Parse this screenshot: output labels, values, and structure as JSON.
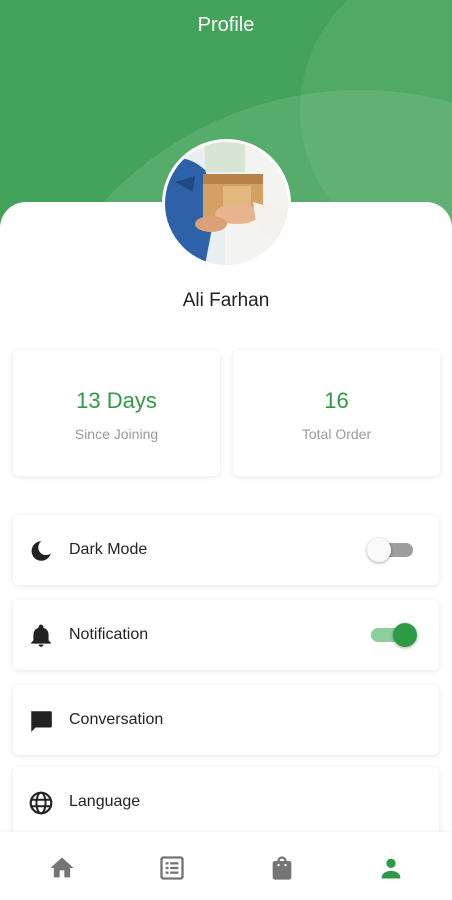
{
  "header": {
    "title": "Profile"
  },
  "user": {
    "name": "Ali Farhan"
  },
  "stats": [
    {
      "value": "13 Days",
      "label": "Since Joining"
    },
    {
      "value": "16",
      "label": "Total Order"
    }
  ],
  "settings": {
    "dark_mode": {
      "label": "Dark Mode",
      "icon": "moon-icon",
      "enabled": false
    },
    "notification": {
      "label": "Notification",
      "icon": "bell-icon",
      "enabled": true
    },
    "conversation": {
      "label": "Conversation",
      "icon": "chat-icon"
    },
    "language": {
      "label": "Language",
      "icon": "globe-icon"
    }
  },
  "bottom_nav": {
    "items": [
      {
        "icon": "home-icon",
        "active": false
      },
      {
        "icon": "list-icon",
        "active": false
      },
      {
        "icon": "shopping-bag-icon",
        "active": false
      },
      {
        "icon": "person-icon",
        "active": true
      }
    ]
  },
  "colors": {
    "primary": "#43a35a",
    "accent": "#2f9a45",
    "inactive_icon": "#757575"
  }
}
